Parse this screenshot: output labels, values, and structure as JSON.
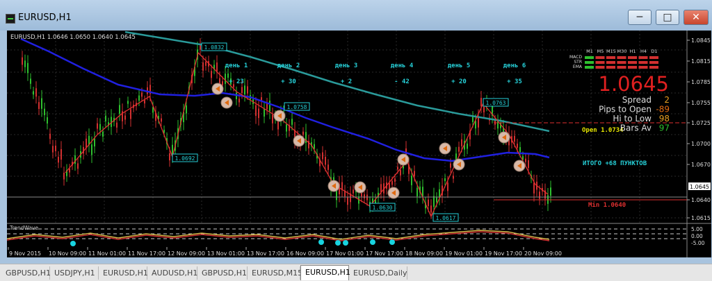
{
  "window": {
    "title": "EURUSD,H1",
    "minimize": "─",
    "maximize": "□",
    "close": "✕"
  },
  "chart": {
    "header": "EURUSD,H1  1.0646 1.0650 1.0640 1.0645",
    "price_labels": [
      "1.0845",
      "1.0815",
      "1.0785",
      "1.0755",
      "1.0725",
      "1.0700",
      "1.0670",
      "1.0645",
      "1.0640",
      "1.0615"
    ],
    "current_price": "1.0645",
    "indicator_name": "TrendWave",
    "indicator_levels": [
      "5.00",
      "0.00",
      "-5.00"
    ],
    "time_labels": [
      "9 Nov 2015",
      "10 Nov 09:00",
      "11 Nov 01:00",
      "11 Nov 17:00",
      "12 Nov 09:00",
      "13 Nov 01:00",
      "13 Nov 17:00",
      "16 Nov 09:00",
      "17 Nov 01:00",
      "17 Nov 17:00",
      "18 Nov 09:00",
      "19 Nov 01:00",
      "19 Nov 17:00",
      "20 Nov 09:00"
    ],
    "day_labels": [
      "день 1",
      "день 2",
      "день 3",
      "день 4",
      "день 5",
      "день 6"
    ],
    "day_pips": [
      "+ 23",
      "+ 30",
      "+ 2",
      "- 42",
      "+ 20",
      "+ 35"
    ],
    "swing_boxes": [
      "1.0832",
      "1.0758",
      "1.0692",
      "1.0630",
      "1.0617",
      "1.0763"
    ],
    "total": "ИТОГО +68 ПУНКТОВ",
    "open_label": "Open  1.0734",
    "min_label": "Min  1.0640"
  },
  "panel": {
    "timeframes": [
      "M1",
      "M5",
      "M15",
      "M30",
      "H1",
      "H4",
      "D1"
    ],
    "rows": [
      "MACD",
      "STR",
      "EMA"
    ],
    "price": "1.0645",
    "stats": [
      {
        "label": "Spread",
        "value": "2"
      },
      {
        "label": "Pips to Open",
        "value": "-89"
      },
      {
        "label": "Hi to Low",
        "value": "98"
      },
      {
        "label": "Bars Av",
        "value": "97"
      }
    ]
  },
  "tabs": [
    "GBPUSD,H1",
    "USDJPY,H1",
    "EURUSD,H1",
    "AUDUSD,H1",
    "GBPUSD,H1",
    "EURUSD,M15",
    "EURUSD,H1",
    "EURUSD,Daily"
  ],
  "active_tab": 6,
  "colors": {
    "bull": "#2ec02e",
    "bear": "#d23030",
    "ma_fast": "#2020e0",
    "ma_slow": "#2a9a9a",
    "label": "#26d0d8",
    "zigzag": "#e03030"
  }
}
